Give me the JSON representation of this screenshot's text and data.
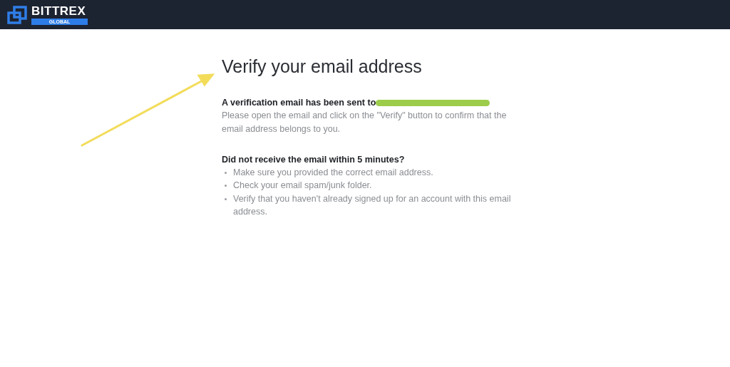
{
  "header": {
    "logo_name": "BITTREX",
    "logo_subtitle": "GLOBAL"
  },
  "content": {
    "title": "Verify your email address",
    "sent_notice": "A verification email has been sent to",
    "instructions": "Please open the email and click on the \"Verify\" button to confirm that the email address belongs to you.",
    "question": "Did not receive the email within 5 minutes?",
    "tips": [
      "Make sure you provided the correct email address.",
      "Check your email spam/junk folder.",
      "Verify that you haven't already signed up for an account with this email address."
    ]
  }
}
